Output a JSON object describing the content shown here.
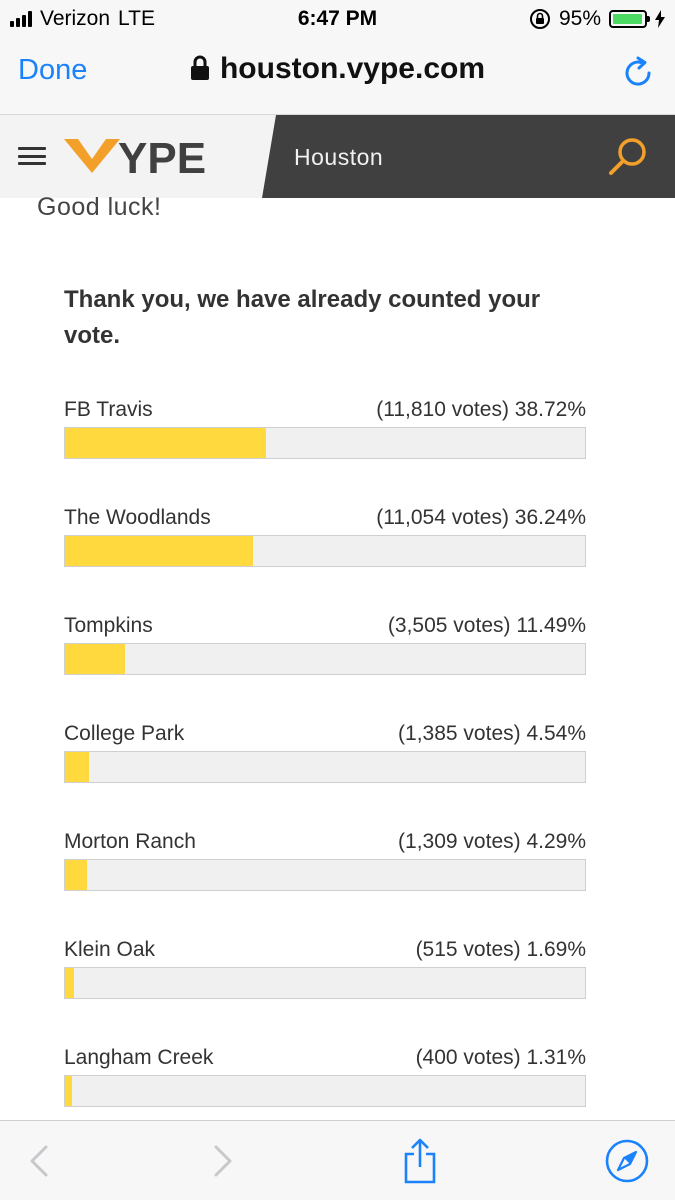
{
  "status_bar": {
    "carrier": "Verizon",
    "network": "LTE",
    "time": "6:47 PM",
    "battery_pct": "95%",
    "battery_level": 0.95
  },
  "browser": {
    "done_label": "Done",
    "url": "houston.vype.com"
  },
  "site_header": {
    "logo_text": "VYPE",
    "region": "Houston"
  },
  "content": {
    "intro": "Good luck!",
    "thanks": "Thank you, we have already counted your vote."
  },
  "poll": {
    "options": [
      {
        "name": "FB Travis",
        "votes_text": "(11,810 votes) 38.72%",
        "percent": 38.72
      },
      {
        "name": "The Woodlands",
        "votes_text": "(11,054 votes) 36.24%",
        "percent": 36.24
      },
      {
        "name": "Tompkins",
        "votes_text": "(3,505 votes) 11.49%",
        "percent": 11.49
      },
      {
        "name": "College Park",
        "votes_text": "(1,385 votes) 4.54%",
        "percent": 4.54
      },
      {
        "name": "Morton Ranch",
        "votes_text": "(1,309 votes) 4.29%",
        "percent": 4.29
      },
      {
        "name": "Klein Oak",
        "votes_text": "(515 votes) 1.69%",
        "percent": 1.69
      },
      {
        "name": "Langham Creek",
        "votes_text": "(400 votes) 1.31%",
        "percent": 1.31
      }
    ],
    "fill_color": "#ffd93d"
  },
  "colors": {
    "ios_blue": "#1a82fb",
    "brand_orange": "#f3a02b",
    "header_dark": "#404041"
  }
}
